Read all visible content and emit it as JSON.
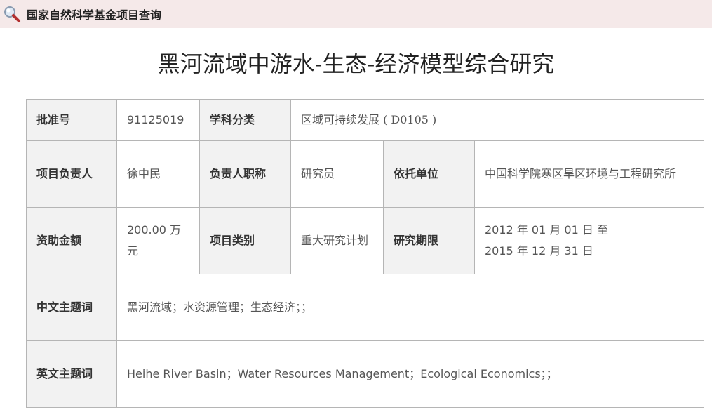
{
  "header": {
    "title": "国家自然科学基金项目查询",
    "icon": "search-icon"
  },
  "page_title": "黑河流域中游水-生态-经济模型综合研究",
  "fields": {
    "approval_no": {
      "label": "批准号",
      "value": "91125019"
    },
    "discipline": {
      "label": "学科分类",
      "value": "区域可持续发展 ( D0105 )"
    },
    "pi": {
      "label": "项目负责人",
      "value": "徐中民"
    },
    "pi_title": {
      "label": "负责人职称",
      "value": "研究员"
    },
    "institution": {
      "label": "依托单位",
      "value": "中国科学院寒区旱区环境与工程研究所"
    },
    "funding": {
      "label": "资助金额",
      "value": "200.00 万元"
    },
    "category": {
      "label": "项目类别",
      "value": "重大研究计划"
    },
    "period": {
      "label": "研究期限",
      "value_start": "2012 年 01 月 01 日 至",
      "value_end": "2015 年 12 月 31 日"
    },
    "cn_keywords": {
      "label": "中文主题词",
      "value": "黑河流域；水资源管理；生态经济；；"
    },
    "en_keywords": {
      "label": "英文主题词",
      "value": "Heihe River Basin；Water Resources Management；Ecological Economics；；"
    }
  }
}
